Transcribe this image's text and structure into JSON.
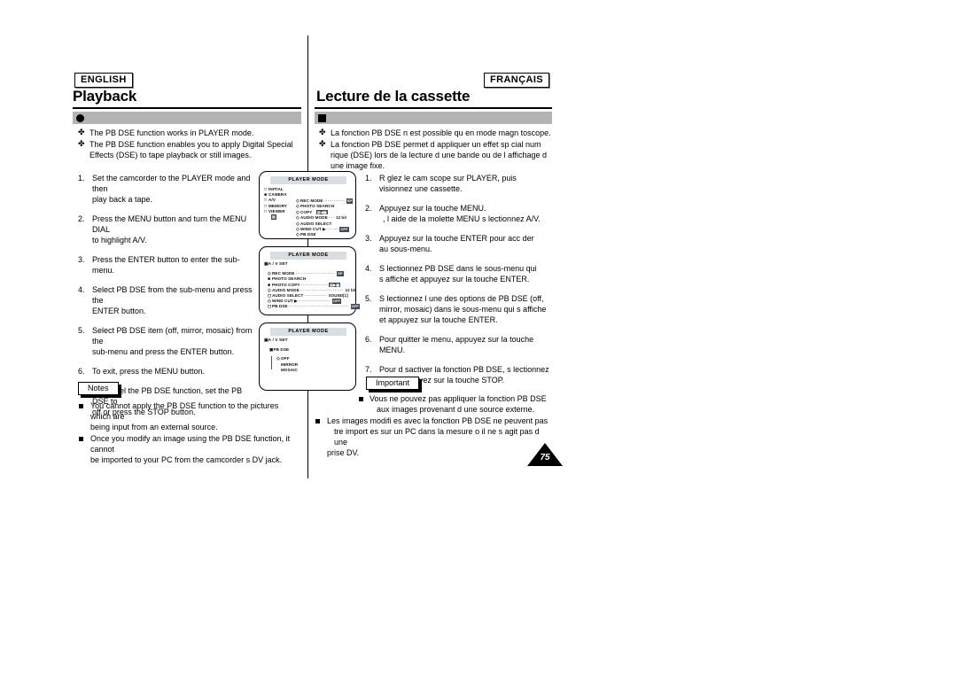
{
  "page": {
    "number": "75"
  },
  "english": {
    "lang_tag": "ENGLISH",
    "heading": "Playback",
    "topic_title": "",
    "intro": [
      "The PB DSE function works in PLAYER mode.",
      "The PB DSE function enables you to apply Digital Special Effects (DSE) to tape playback or still images."
    ],
    "steps": [
      {
        "num": "1.",
        "lines": [
          "Set the camcorder to the PLAYER mode and then",
          "play back a tape."
        ]
      },
      {
        "num": "2.",
        "lines": [
          "Press the MENU button and turn the MENU DIAL",
          "to highlight A/V."
        ]
      },
      {
        "num": "3.",
        "lines": [
          "Press the ENTER button to enter the sub-menu."
        ]
      },
      {
        "num": "4.",
        "lines": [
          "Select PB DSE from the sub-menu and press the",
          "ENTER button."
        ]
      },
      {
        "num": "5.",
        "lines": [
          "Select PB DSE item (off, mirror, mosaic) from the",
          "sub-menu and press the ENTER button."
        ]
      },
      {
        "num": "6.",
        "lines": [
          "To exit, press the MENU button."
        ]
      },
      {
        "num": "7.",
        "lines": [
          "To cancel the PB DSE function, set the PB DSE to",
          "off or press the STOP button."
        ]
      }
    ],
    "notes_tab": "Notes",
    "notes": [
      [
        "You cannot apply the PB DSE function to the pictures which are",
        "being input from an external source."
      ],
      [
        "Once you modify an image using the PB DSE function, it cannot",
        "be imported to your PC from the camcorder s DV jack."
      ]
    ]
  },
  "french": {
    "lang_tag": "FRANÇAIS",
    "heading": "Lecture de la cassette",
    "topic_title": "",
    "intro": [
      "La fonction PB  DSE n est possible qu en mode magn  toscope.",
      "La fonction PB DSE permet d appliquer un effet sp  cial num  rique (DSE) lors de la lecture d une bande ou de l affichage d une image fixe."
    ],
    "steps": [
      {
        "num": "1.",
        "lines": [
          "R  glez le cam  scope sur PLAYER, puis",
          "visionnez une cassette."
        ]
      },
      {
        "num": "2.",
        "lines": [
          "Appuyez sur la touche MENU.",
          ",  l aide de la molette MENU s  lectionnez A/V."
        ]
      },
      {
        "num": "3.",
        "lines": [
          "Appuyez sur la touche ENTER pour acc  der",
          "au sous-menu."
        ]
      },
      {
        "num": "4.",
        "lines": [
          "S  lectionnez PB DSE dans le sous-menu qui",
          "s affiche et appuyez sur la touche ENTER."
        ]
      },
      {
        "num": "5.",
        "lines": [
          "S  lectionnez l une des options de PB DSE (off,",
          "mirror, mosaic) dans le sous-menu qui s affiche",
          "et appuyez sur la touche ENTER."
        ]
      },
      {
        "num": "6.",
        "lines": [
          "Pour quitter le menu, appuyez sur la touche",
          "MENU."
        ]
      },
      {
        "num": "7.",
        "lines": [
          "Pour d  sactiver la fonction PB DSE, s  lectionnez",
          "off ou appuyez sur la touche STOP."
        ]
      }
    ],
    "notes_tab": "Important",
    "notes": [
      {
        "indented": true,
        "lines": [
          "Vous ne pouvez pas appliquer la fonction PB DSE",
          "aux images provenant d une source externe."
        ]
      },
      {
        "indented": false,
        "lines": [
          "Les images modifi  es avec la fonction PB DSE ne peuvent pas",
          " tre import  es sur un PC dans la mesure o   il ne s agit pas d une",
          "prise DV."
        ]
      }
    ]
  },
  "lcd_panels": [
    {
      "id": "lcd-menu-main",
      "title": "PLAYER MODE",
      "left_column": [
        {
          "icon": "□",
          "label": "INITIAL"
        },
        {
          "icon": "■",
          "label": "CAMERA"
        },
        {
          "icon": "□",
          "label": "A/V"
        },
        {
          "icon": "□",
          "label": "MEMORY"
        },
        {
          "icon": "□",
          "label": "VIEWER"
        },
        {
          "icon": "",
          "label": ""
        }
      ],
      "right_column": [
        {
          "icon": "◇",
          "label": "REC MODE",
          "dots": "···········",
          "value": "SP",
          "value_style": "chip"
        },
        {
          "icon": "◇",
          "label": "PHOTO SEARCH",
          "dots": "",
          "value": "",
          "value_style": "none"
        },
        {
          "icon": "◇",
          "label": "COPY",
          "dots": "",
          "value": "▤◀▦",
          "value_style": "chip"
        },
        {
          "icon": "◇",
          "label": "AUDIO MODE",
          "dots": "···",
          "value": "12 bit",
          "value_style": "plain"
        },
        {
          "icon": "◇",
          "label": "AUDIO SELECT",
          "dots": "",
          "value": "",
          "value_style": "none"
        },
        {
          "icon": "◇",
          "label": "WIND CUT ▶",
          "dots": "······",
          "value": "OFF",
          "value_style": "chip"
        },
        {
          "icon": "◇",
          "label": "PB DSE",
          "dots": "",
          "value": "",
          "value_style": "none"
        }
      ]
    },
    {
      "id": "lcd-menu-av-set",
      "title": "PLAYER MODE",
      "subhead": "▣A / V SET",
      "rows": [
        {
          "icon": "◇",
          "label": "REC MODE",
          "dots": "·····················",
          "value": "SP",
          "value_style": "chip"
        },
        {
          "icon": "■",
          "label": "PHOTO SEARCH",
          "dots": "",
          "value": "",
          "value_style": "none"
        },
        {
          "icon": "■",
          "label": "PHOTO COPY",
          "dots": "··············",
          "value": "▤▶▦",
          "value_style": "chip"
        },
        {
          "icon": "◇",
          "label": "AUDIO MODE",
          "dots": "·······················",
          "value": "12 bit",
          "value_style": "plain"
        },
        {
          "icon": "◻",
          "label": "AUDIO SELECT",
          "dots": "············",
          "value": "SOUND[1]",
          "value_style": "plain"
        },
        {
          "icon": "◇",
          "label": "WIND CUT ▶",
          "dots": "·················",
          "value": "OFF",
          "value_style": "chip"
        },
        {
          "icon": "◻",
          "label": "PB DSE",
          "dots": "································",
          "value": "OFF",
          "value_style": "chip"
        }
      ]
    },
    {
      "id": "lcd-menu-pb-dse",
      "title": "PLAYER MODE",
      "subhead": "▣A / V SET",
      "branch_label": "▣PB DSE",
      "options": [
        {
          "icon": "◇",
          "label": "OFF"
        },
        {
          "icon": "",
          "label": "MIRROR"
        },
        {
          "icon": "",
          "label": "MOSAIC"
        }
      ]
    }
  ]
}
